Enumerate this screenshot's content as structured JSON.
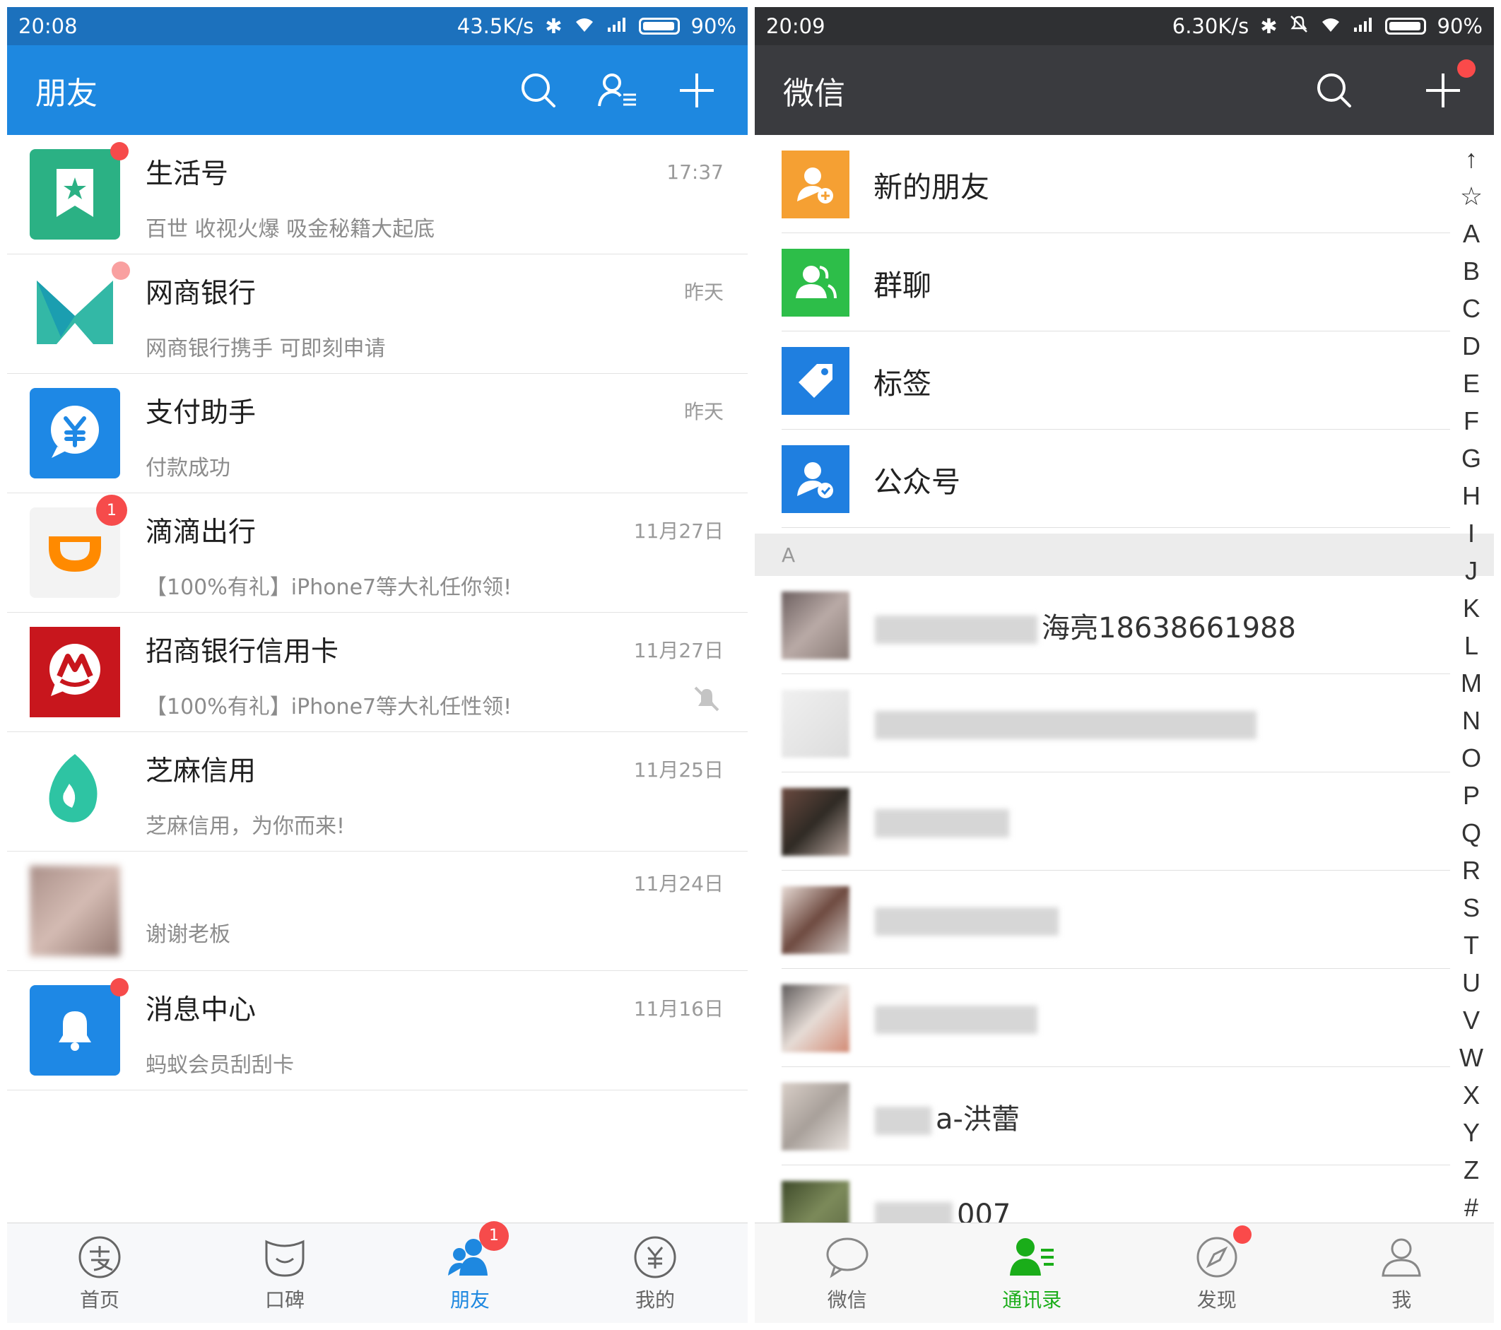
{
  "alipay": {
    "status": {
      "time": "20:08",
      "speed": "43.5K/s",
      "battery": "90%"
    },
    "header": {
      "title": "朋友"
    },
    "messages": [
      {
        "name": "生活号",
        "time": "17:37",
        "preview": "百世 收视火爆 吸金秘籍大起底",
        "avatar_color": "#2bb184",
        "avatar_icon": "bookmark-star-icon"
      },
      {
        "name": "网商银行",
        "time": "昨天",
        "preview": "网商银行携手 可即刻申请",
        "avatar_color": "#ffffff",
        "avatar_icon": "mybank-logo"
      },
      {
        "name": "支付助手",
        "time": "昨天",
        "preview": "付款成功",
        "avatar_color": "#1e88e5",
        "avatar_icon": "yuan-bubble-icon"
      },
      {
        "name": "滴滴出行",
        "time": "11月27日",
        "preview": "【100%有礼】iPhone7等大礼任你领!",
        "badge": "1",
        "avatar_color": "#f3f3f3",
        "avatar_icon": "didi-logo"
      },
      {
        "name": "招商银行信用卡",
        "time": "11月27日",
        "preview": "【100%有礼】iPhone7等大礼任性领!",
        "avatar_color": "#c8161d",
        "avatar_icon": "cmb-logo"
      },
      {
        "name": "芝麻信用",
        "time": "11月25日",
        "preview": "芝麻信用，为你而来!",
        "avatar_color": "#ffffff",
        "avatar_icon": "sesame-logo"
      },
      {
        "name": "",
        "time": "11月24日",
        "preview": "谢谢老板",
        "avatar_color": "#8f6c63",
        "avatar_icon": "user-photo"
      },
      {
        "name": "消息中心",
        "time": "11月16日",
        "preview": "蚂蚁会员刮刮卡",
        "avatar_color": "#1e88e5",
        "avatar_icon": "bell-icon"
      }
    ],
    "tabs": [
      {
        "label": "首页",
        "icon": "alipay-home-icon"
      },
      {
        "label": "口碑",
        "icon": "koubei-icon"
      },
      {
        "label": "朋友",
        "icon": "friends-icon",
        "badge": "1",
        "active": true
      },
      {
        "label": "我的",
        "icon": "yuan-circle-icon"
      }
    ],
    "accent": "#1e88e0"
  },
  "wechat": {
    "status": {
      "time": "20:09",
      "speed": "6.30K/s",
      "battery": "90%"
    },
    "header": {
      "title": "微信"
    },
    "fixed_items": [
      {
        "label": "新的朋友",
        "color": "#f5a033",
        "icon": "new-friend-icon"
      },
      {
        "label": "群聊",
        "color": "#2dbe49",
        "icon": "group-chat-icon"
      },
      {
        "label": "标签",
        "color": "#1f7fe0",
        "icon": "tag-icon"
      },
      {
        "label": "公众号",
        "color": "#1f7fe0",
        "icon": "official-account-icon"
      }
    ],
    "section_letter": "A",
    "contacts": [
      {
        "name": "海亮18638661988"
      },
      {
        "name": ""
      },
      {
        "name": ""
      },
      {
        "name": ""
      },
      {
        "name": ""
      },
      {
        "name": "a-洪蕾"
      },
      {
        "name": "007"
      }
    ],
    "index_letters": [
      "↑",
      "☆",
      "A",
      "B",
      "C",
      "D",
      "E",
      "F",
      "G",
      "H",
      "I",
      "J",
      "K",
      "L",
      "M",
      "N",
      "O",
      "P",
      "Q",
      "R",
      "S",
      "T",
      "U",
      "V",
      "W",
      "X",
      "Y",
      "Z",
      "#"
    ],
    "tabs": [
      {
        "label": "微信",
        "icon": "chat-bubble-icon"
      },
      {
        "label": "通讯录",
        "icon": "contacts-icon",
        "active": true
      },
      {
        "label": "发现",
        "icon": "compass-icon",
        "dot": true
      },
      {
        "label": "我",
        "icon": "person-icon"
      }
    ],
    "accent": "#1aad19"
  }
}
